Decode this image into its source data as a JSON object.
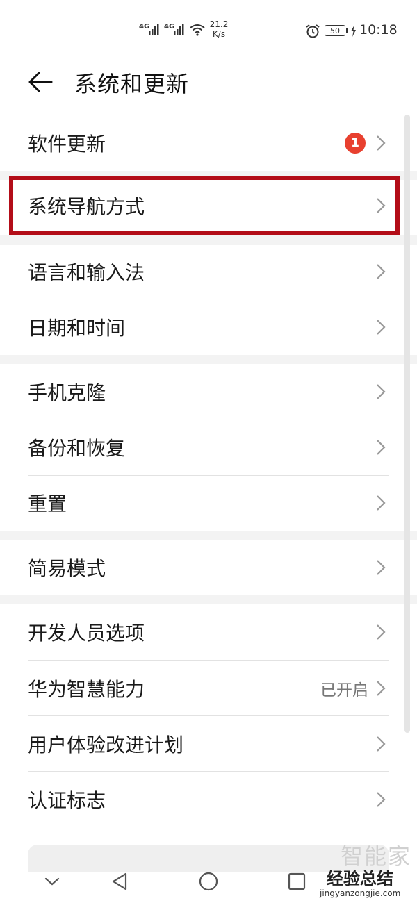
{
  "status_bar": {
    "signal1_label": "4G",
    "signal2_label": "4G",
    "speed_value": "21.2",
    "speed_unit": "K/s",
    "battery": "50",
    "time": "10:18",
    "icons": [
      "alarm-icon",
      "charging-icon",
      "wifi-icon",
      "signal-icon"
    ]
  },
  "header": {
    "title": "系统和更新",
    "back_icon": "back-arrow-icon"
  },
  "items": [
    {
      "label": "软件更新",
      "badge": "1"
    },
    {
      "label": "系统导航方式"
    },
    {
      "label": "语言和输入法"
    },
    {
      "label": "日期和时间"
    },
    {
      "label": "手机克隆"
    },
    {
      "label": "备份和恢复"
    },
    {
      "label": "重置"
    },
    {
      "label": "简易模式"
    },
    {
      "label": "开发人员选项"
    },
    {
      "label": "华为智慧能力",
      "value": "已开启"
    },
    {
      "label": "用户体验改进计划"
    },
    {
      "label": "认证标志"
    }
  ],
  "highlight_color": "#b30d18",
  "watermark": {
    "line1": "智能家",
    "line2": "经验总结",
    "url": "jingyanzongjie.com"
  },
  "nav_icons": [
    "collapse-icon",
    "back-triangle-icon",
    "home-circle-icon",
    "recents-square-icon"
  ]
}
